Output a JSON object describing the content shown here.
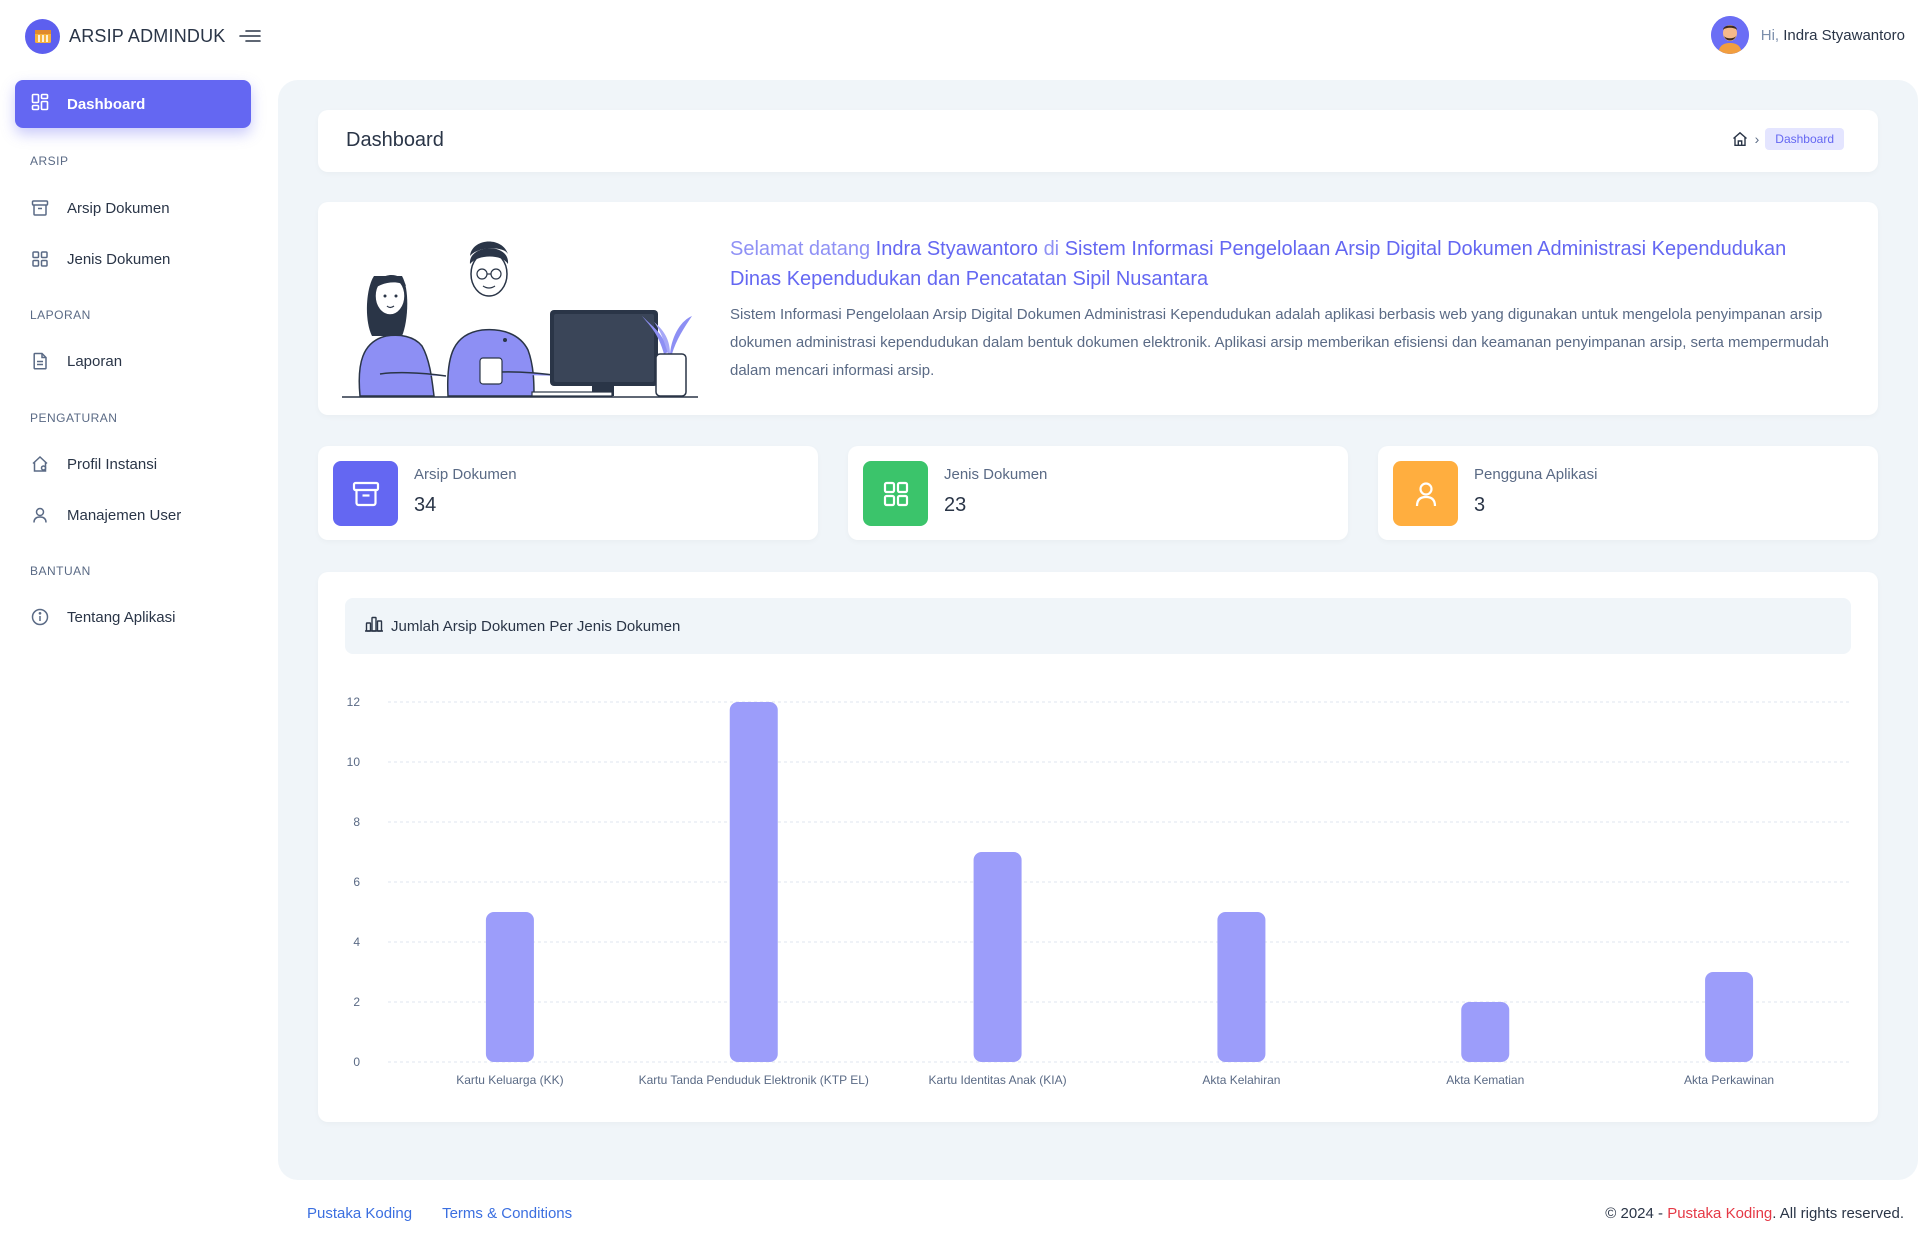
{
  "brand": {
    "name": "ARSIP ADMINDUK"
  },
  "sidebar": {
    "active": {
      "label": "Dashboard",
      "icon": "dashboard-icon"
    },
    "sections": [
      {
        "title": "ARSIP",
        "items": [
          {
            "label": "Arsip Dokumen",
            "icon": "archive-icon"
          },
          {
            "label": "Jenis Dokumen",
            "icon": "category-icon"
          }
        ]
      },
      {
        "title": "LAPORAN",
        "items": [
          {
            "label": "Laporan",
            "icon": "report-icon"
          }
        ]
      },
      {
        "title": "PENGATURAN",
        "items": [
          {
            "label": "Profil Instansi",
            "icon": "building-icon"
          },
          {
            "label": "Manajemen User",
            "icon": "user-icon"
          }
        ]
      },
      {
        "title": "BANTUAN",
        "items": [
          {
            "label": "Tentang Aplikasi",
            "icon": "info-icon"
          }
        ]
      }
    ]
  },
  "header": {
    "greeting": "Hi,",
    "user_name": "Indra Styawantoro"
  },
  "page": {
    "title": "Dashboard",
    "breadcrumb_current": "Dashboard"
  },
  "welcome": {
    "pre": "Selamat datang",
    "name": "Indra Styawantoro",
    "mid": "di",
    "system": "Sistem Informasi Pengelolaan Arsip Digital Dokumen Administrasi Kependudukan Dinas Kependudukan dan Pencatatan Sipil Nusantara",
    "description": "Sistem Informasi Pengelolaan Arsip Digital Dokumen Administrasi Kependudukan adalah aplikasi berbasis web yang digunakan untuk mengelola penyimpanan arsip dokumen administrasi kependudukan dalam bentuk dokumen elektronik. Aplikasi arsip memberikan efisiensi dan keamanan penyimpanan arsip, serta mempermudah dalam mencari informasi arsip."
  },
  "stats": [
    {
      "label": "Arsip Dokumen",
      "value": "34",
      "color": "#6467f2",
      "icon": "archive-icon"
    },
    {
      "label": "Jenis Dokumen",
      "value": "23",
      "color": "#3bc46b",
      "icon": "category-icon"
    },
    {
      "label": "Pengguna Aplikasi",
      "value": "3",
      "color": "#ffae3f",
      "icon": "user-icon"
    }
  ],
  "chart_card": {
    "title": "Jumlah Arsip Dokumen Per Jenis Dokumen"
  },
  "chart_data": {
    "type": "bar",
    "title": "Jumlah Arsip Dokumen Per Jenis Dokumen",
    "categories": [
      "Kartu Keluarga (KK)",
      "Kartu Tanda Penduduk Elektronik (KTP EL)",
      "Kartu Identitas Anak (KIA)",
      "Akta Kelahiran",
      "Akta Kematian",
      "Akta Perkawinan"
    ],
    "values": [
      5,
      12,
      7,
      5,
      2,
      3
    ],
    "ylim": [
      0,
      12
    ],
    "yticks": [
      0,
      2,
      4,
      6,
      8,
      10,
      12
    ],
    "grid": true,
    "bar_color": "#9c9dfa"
  },
  "footer": {
    "links": [
      "Pustaka Koding",
      "Terms & Conditions"
    ],
    "copy_prefix": "© 2024 -",
    "copy_brand": "Pustaka Koding",
    "copy_suffix": ". All rights reserved."
  }
}
